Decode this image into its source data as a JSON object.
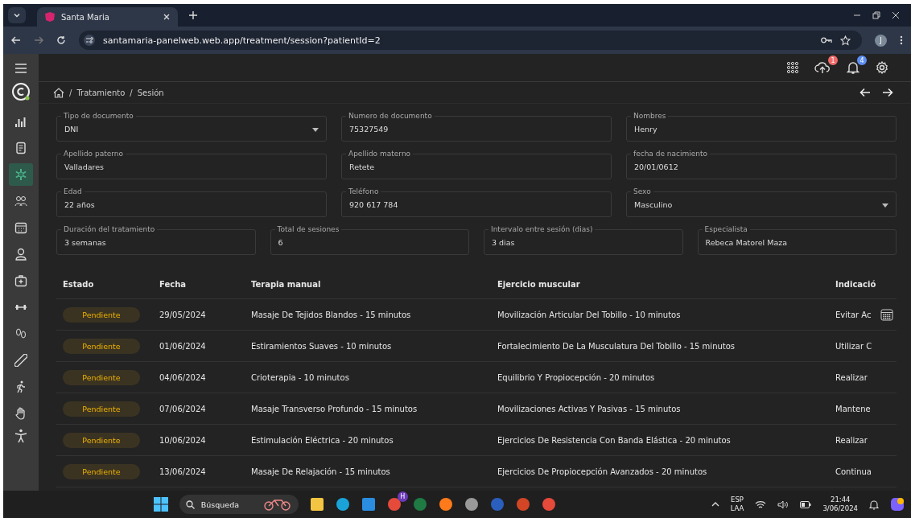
{
  "browser": {
    "tab_title": "Santa Maria",
    "url": "santamaria-panelweb.web.app/treatment/session?patientId=2",
    "profile": "J"
  },
  "topbar": {
    "upload_badge": "1",
    "notifications_badge": "4"
  },
  "sidebar": {
    "items": [
      {
        "selected": false
      },
      {
        "selected": false
      },
      {
        "selected": true
      },
      {
        "selected": false
      },
      {
        "selected": false
      },
      {
        "selected": false
      },
      {
        "selected": false
      },
      {
        "selected": false
      },
      {
        "selected": false
      },
      {
        "selected": false
      },
      {
        "selected": false
      },
      {
        "selected": false
      }
    ]
  },
  "breadcrumb": [
    {
      "separator": "/",
      "label": "Tratamiento"
    },
    {
      "separator": "/",
      "label": "Sesión"
    }
  ],
  "form": {
    "rows": [
      [
        {
          "label": "Tipo de documento",
          "value": "DNI",
          "kind": "select"
        },
        {
          "label": "Numero de documento",
          "value": "75327549",
          "kind": "text"
        },
        {
          "label": "Nombres",
          "value": "Henry",
          "kind": "text"
        }
      ],
      [
        {
          "label": "Apellido paterno",
          "value": "Valladares",
          "kind": "text"
        },
        {
          "label": "Apellido materno",
          "value": "Retete",
          "kind": "text"
        },
        {
          "label": "fecha de nacimiento",
          "value": "20/01/0612",
          "kind": "text"
        }
      ],
      [
        {
          "label": "Edad",
          "value": "22 años",
          "kind": "text"
        },
        {
          "label": "Teléfono",
          "value": "920 617 784",
          "kind": "text"
        },
        {
          "label": "Sexo",
          "value": "Masculino",
          "kind": "select"
        }
      ],
      [
        {
          "label": "Duración del tratamiento",
          "value": "3 semanas",
          "kind": "text"
        },
        {
          "label": "Total de sesiones",
          "value": "6",
          "kind": "text"
        },
        {
          "label": "Intervalo entre sesión (dias)",
          "value": "3 dias",
          "kind": "text"
        },
        {
          "label": "Especialista",
          "value": "Rebeca Matorel Maza",
          "kind": "text"
        }
      ]
    ]
  },
  "table": {
    "columns": [
      "Estado",
      "Fecha",
      "Terapia manual",
      "Ejercicio muscular",
      "Indicació"
    ],
    "rows": [
      {
        "status": "Pendiente",
        "date": "29/05/2024",
        "therapy": "Masaje De Tejidos Blandos - 15 minutos",
        "exercise": "Movilización Articular Del Tobillo - 10 minutos",
        "indication": "Evitar Ac"
      },
      {
        "status": "Pendiente",
        "date": "01/06/2024",
        "therapy": "Estiramientos Suaves - 10 minutos",
        "exercise": "Fortalecimiento De La Musculatura Del Tobillo - 15 minutos",
        "indication": "Utilizar C"
      },
      {
        "status": "Pendiente",
        "date": "04/06/2024",
        "therapy": "Crioterapia - 10 minutos",
        "exercise": "Equilibrio Y Propiocepción - 20 minutos",
        "indication": "Realizar"
      },
      {
        "status": "Pendiente",
        "date": "07/06/2024",
        "therapy": "Masaje Transverso Profundo - 15 minutos",
        "exercise": "Movilizaciones Activas Y Pasivas - 15 minutos",
        "indication": "Mantene"
      },
      {
        "status": "Pendiente",
        "date": "10/06/2024",
        "therapy": "Estimulación Eléctrica - 20 minutos",
        "exercise": "Ejercicios De Resistencia Con Banda Elástica - 20 minutos",
        "indication": "Realizar"
      },
      {
        "status": "Pendiente",
        "date": "13/06/2024",
        "therapy": "Masaje De Relajación - 15 minutos",
        "exercise": "Ejercicios De Propiocepción Avanzados - 20 minutos",
        "indication": "Continua"
      }
    ]
  },
  "taskbar": {
    "search_placeholder": "Búsqueda",
    "chrome_badge": "H",
    "language": "ESP",
    "layout": "LAA",
    "time": "21:44",
    "date": "3/06/2024"
  }
}
